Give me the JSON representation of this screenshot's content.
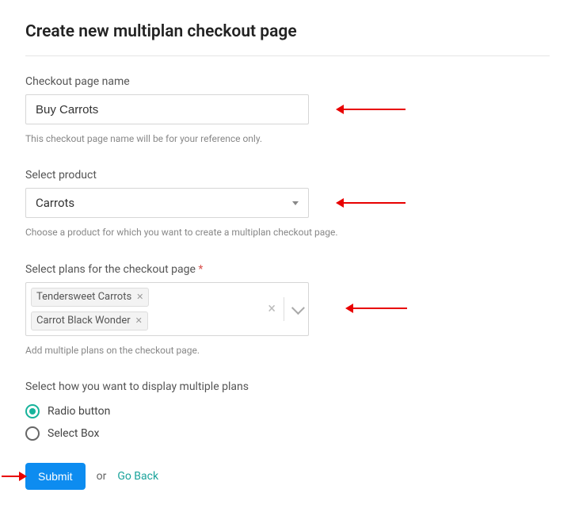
{
  "page_title": "Create new multiplan checkout page",
  "fields": {
    "name": {
      "label": "Checkout page name",
      "value": "Buy Carrots",
      "helper": "This checkout page name will be for your reference only."
    },
    "product": {
      "label": "Select product",
      "value": "Carrots",
      "helper": "Choose a product for which you want to create a multiplan checkout page."
    },
    "plans": {
      "label": "Select plans for the checkout page",
      "required_mark": "*",
      "tags": [
        "Tendersweet Carrots",
        "Carrot Black Wonder"
      ],
      "helper": "Add multiple plans on the checkout page."
    },
    "display": {
      "label": "Select how you want to display multiple plans",
      "options": [
        {
          "label": "Radio button",
          "selected": true
        },
        {
          "label": "Select Box",
          "selected": false
        }
      ]
    }
  },
  "actions": {
    "submit": "Submit",
    "or": "or",
    "go_back": "Go Back"
  }
}
